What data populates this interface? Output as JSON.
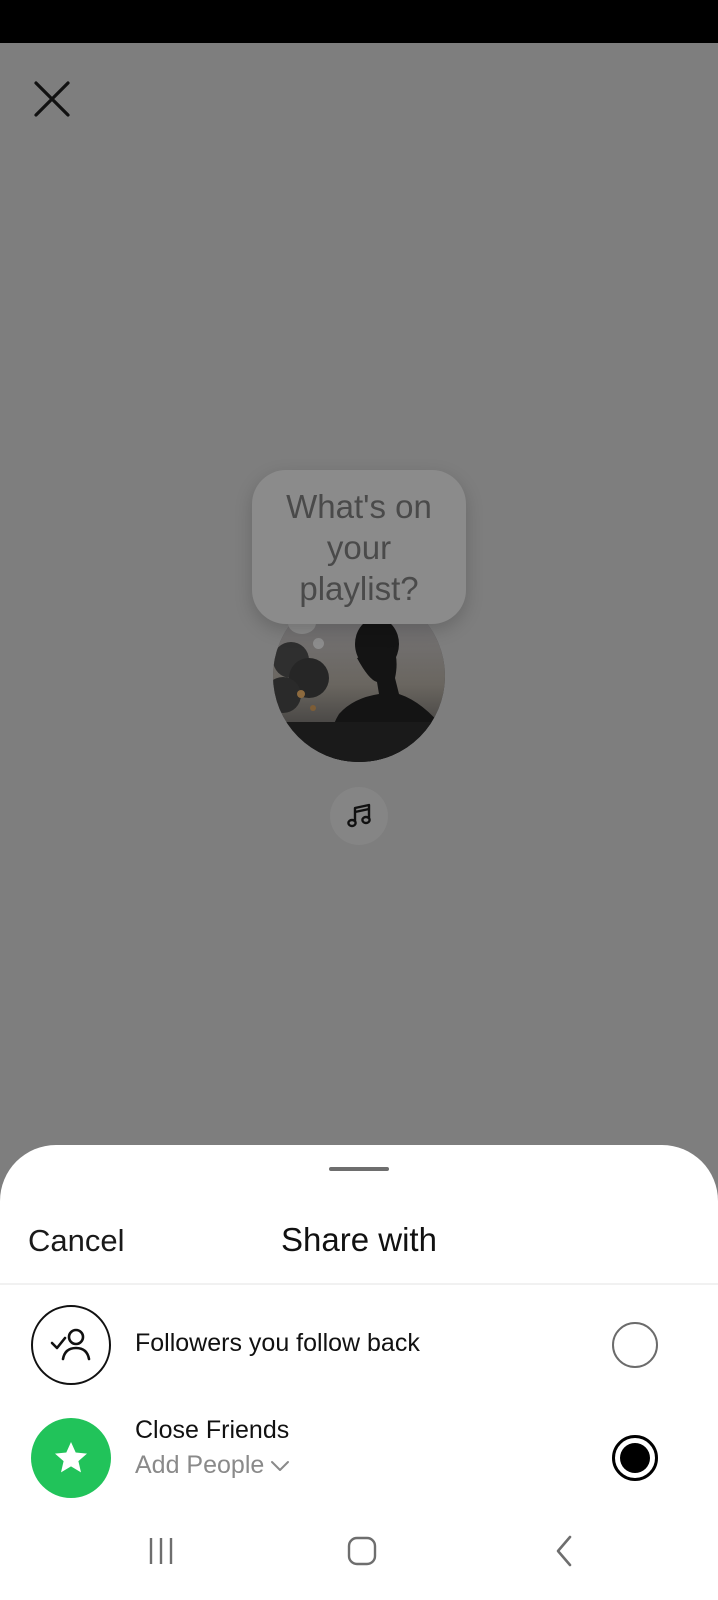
{
  "note": {
    "placeholder": "What's on your playlist?"
  },
  "icons": {
    "close": "close-icon",
    "music": "music-note-icon",
    "followers": "user-check-icon",
    "close_friends": "star-icon",
    "chevron": "chevron-down-icon"
  },
  "sheet": {
    "cancel_label": "Cancel",
    "title": "Share with",
    "options": [
      {
        "label": "Followers you follow back",
        "selected": false
      },
      {
        "label": "Close Friends",
        "sublabel": "Add People",
        "selected": true
      }
    ]
  },
  "colors": {
    "close_friends_green": "#21C35A",
    "overlay": "#7E7E7E"
  }
}
